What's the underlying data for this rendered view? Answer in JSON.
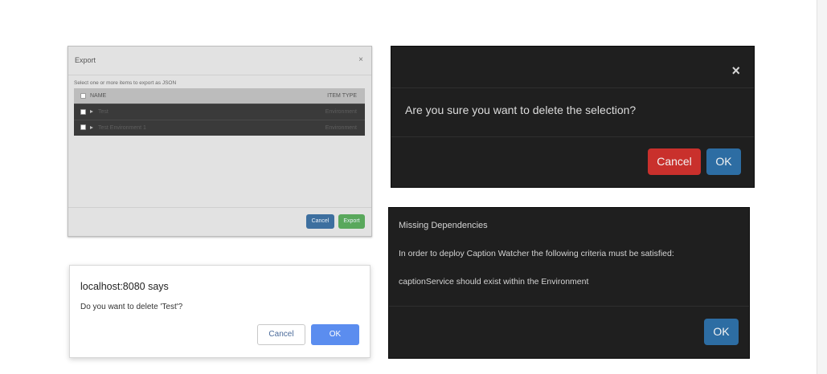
{
  "export_dialog": {
    "title": "Export",
    "close_glyph": "×",
    "hint": "Select one or more items to export as JSON",
    "columns": {
      "name": "NAME",
      "type": "ITEM TYPE"
    },
    "rows": [
      {
        "name": "Test",
        "type": "Environment"
      },
      {
        "name": "Test Environment 1",
        "type": "Environment"
      }
    ],
    "cancel_label": "Cancel",
    "export_label": "Export"
  },
  "delete_dialog": {
    "close_glyph": "×",
    "message": "Are you sure you want to delete the selection?",
    "cancel_label": "Cancel",
    "ok_label": "OK"
  },
  "confirm_dialog": {
    "title": "localhost:8080 says",
    "message": "Do you want to delete 'Test'?",
    "cancel_label": "Cancel",
    "ok_label": "OK"
  },
  "deps_dialog": {
    "title": "Missing Dependencies",
    "line1": "In order to deploy Caption Watcher the following criteria must be satisfied:",
    "line2": "captionService should exist within the Environment",
    "ok_label": "OK"
  },
  "colors": {
    "danger": "#c9302c",
    "primary": "#2d6da3",
    "success": "#59a85c",
    "browser_ok": "#5b8def",
    "dark_dialog": "#1f1f1f"
  },
  "icons": [
    "close-icon",
    "checkbox-icon",
    "expand-arrow-icon"
  ]
}
